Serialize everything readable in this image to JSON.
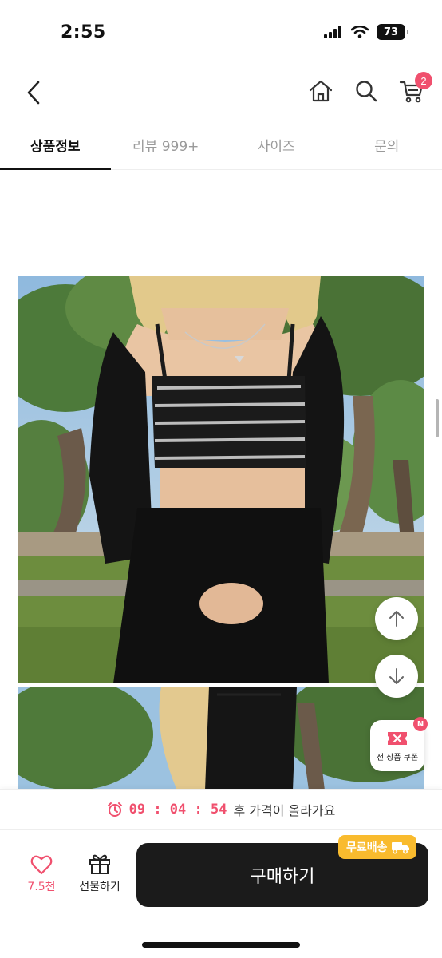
{
  "status_bar": {
    "time": "2:55",
    "battery": "73"
  },
  "header": {
    "cart_count": "2"
  },
  "tabs": [
    {
      "label": "상품정보",
      "active": true
    },
    {
      "label": "리뷰 999+",
      "active": false
    },
    {
      "label": "사이즈",
      "active": false
    },
    {
      "label": "문의",
      "active": false
    }
  ],
  "floating": {
    "coupon_label": "전 상품 쿠폰",
    "coupon_new": "N"
  },
  "timer": {
    "time": "09 : 04 : 54",
    "text": "후 가격이 올라가요"
  },
  "bottom": {
    "like_count": "7.5천",
    "gift_label": "선물하기",
    "buy_label": "구매하기",
    "shipping_badge": "무료배송"
  },
  "colors": {
    "accent": "#f0506e",
    "buy_button": "#1b1b1b",
    "shipping_badge": "#f9bb2e"
  }
}
